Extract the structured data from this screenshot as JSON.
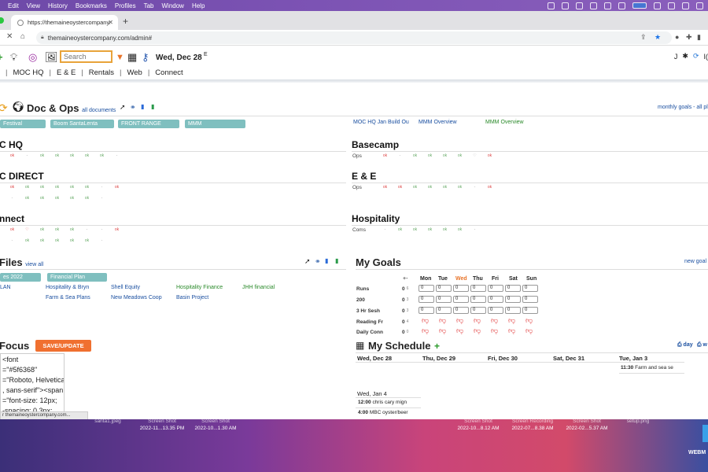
{
  "menubar": {
    "items": [
      "Edit",
      "View",
      "History",
      "Bookmarks",
      "Profiles",
      "Tab",
      "Window",
      "Help"
    ]
  },
  "browser": {
    "tab_title": "https://themaineoystercompany.",
    "url": "themaineoystercompany.com/admin#"
  },
  "toolbar": {
    "search_placeholder": "Search",
    "date": "Wed, Dec 28",
    "date_suffix": "E",
    "user_initial": "J",
    "right_tail": "I("
  },
  "nav": {
    "items": [
      "MOC HQ",
      "E & E",
      "Rentals",
      "Web",
      "Connect"
    ]
  },
  "docops": {
    "title": "Doc & Ops",
    "all_link": "all documents",
    "right_link": "monthly goals - all pl",
    "pills": [
      "Festival",
      "Boom SantaLenta",
      "FRONT RANGE",
      "MMM"
    ],
    "links": [
      "MOC HQ Jan Build Ou",
      "MMM Overview",
      "MMM Overview"
    ]
  },
  "panels": {
    "mochq": "C HQ",
    "direct": "C DIRECT",
    "connect": "nnect",
    "basecamp": "Basecamp",
    "ee": "E & E",
    "hospitality": "Hospitality"
  },
  "row_labels": {
    "ops": "Ops",
    "ops2": "Ops",
    "coms": "Coms"
  },
  "files": {
    "title": "Files",
    "view_all": "view all",
    "pills": [
      "es 2022",
      "Financial Plan"
    ],
    "links": [
      "LAN",
      "Hospitality & Bryn",
      "Shell Equity",
      "Hospitality Finance",
      "JHH financial",
      "Farm & Sea Plans",
      "New Meadows Coop",
      "Basin Project"
    ]
  },
  "goals": {
    "title": "My Goals",
    "new_goal": "new goal",
    "days": [
      "Mon",
      "Tue",
      "Wed",
      "Thu",
      "Fri",
      "Sat",
      "Sun"
    ],
    "today": "Wed",
    "rows": [
      {
        "label": "Runs",
        "count": "0",
        "sub": "6"
      },
      {
        "label": "200",
        "count": "0",
        "sub": "3"
      },
      {
        "label": "3 Hr Sesh",
        "count": "0",
        "sub": "3"
      },
      {
        "label": "Reading Fr",
        "count": "0",
        "sub": "4"
      },
      {
        "label": "Daily Conn",
        "count": "0",
        "sub": "0"
      }
    ],
    "select_value": "0"
  },
  "focus": {
    "title": "Focus",
    "button": "SAVE/UPDATE",
    "code": "<font\n=\"#5f6368\"\n=\"Roboto, Helvetica\n, sans-serif\"><span\n=\"font-size: 12px;\n-spacing: 0.3px;"
  },
  "status_url": "r themaineoystercompany.com...",
  "schedule": {
    "title": "My Schedule",
    "day_link": "day",
    "week_link": "w",
    "days": [
      "Wed, Dec 28",
      "Thu, Dec 29",
      "Fri, Dec 30",
      "Sat, Dec 31",
      "Tue, Jan 3"
    ],
    "event1": {
      "time": "11:30",
      "text": "Farm and sea se"
    },
    "day2": "Wed, Jan 4",
    "events2": [
      {
        "time": "12:00",
        "text": "chris cary mign"
      },
      {
        "time": "4:00",
        "text": "MBC oyster/beer"
      }
    ]
  },
  "desktop": {
    "files": [
      {
        "name": "santa1.jpeg",
        "sub": ""
      },
      {
        "name": "Screen Shot",
        "sub": "2022-11...13.35 PM"
      },
      {
        "name": "Screen Shot",
        "sub": "2022-10...1.30 AM"
      },
      {
        "name": "Screen Shot",
        "sub": "2022-10...8.12 AM"
      },
      {
        "name": "Screen Recording",
        "sub": "2022-07...8.38 AM"
      },
      {
        "name": "Screen Shot",
        "sub": "2022-02...5.37 AM"
      },
      {
        "name": "setup.png",
        "sub": ""
      }
    ],
    "webm": "WEBM"
  }
}
